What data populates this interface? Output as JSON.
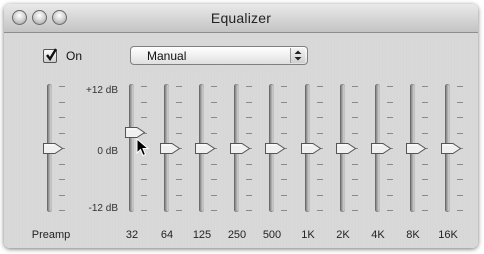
{
  "window": {
    "title": "Equalizer"
  },
  "controls": {
    "on_label": "On",
    "on_checked": true,
    "preset_value": "Manual"
  },
  "scale": {
    "top": "+12 dB",
    "middle": "0 dB",
    "bottom": "-12 dB"
  },
  "preamp": {
    "label": "Preamp",
    "value_db": 0
  },
  "bands": [
    {
      "label": "32",
      "value_db": 3
    },
    {
      "label": "64",
      "value_db": 0
    },
    {
      "label": "125",
      "value_db": 0
    },
    {
      "label": "250",
      "value_db": 0
    },
    {
      "label": "500",
      "value_db": 0
    },
    {
      "label": "1K",
      "value_db": 0
    },
    {
      "label": "2K",
      "value_db": 0
    },
    {
      "label": "4K",
      "value_db": 0
    },
    {
      "label": "8K",
      "value_db": 0
    },
    {
      "label": "16K",
      "value_db": 0
    }
  ],
  "colors": {
    "track": "#8a8a8a",
    "thumb": "#f0f0f0",
    "window_bg": "#d8d8d8"
  }
}
